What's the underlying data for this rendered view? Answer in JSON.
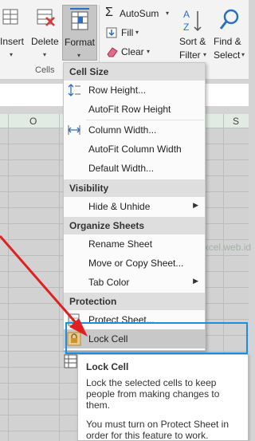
{
  "ribbon": {
    "insert_label": "Insert",
    "delete_label": "Delete",
    "format_label": "Format",
    "cells_group_label": "Cells",
    "autosum_label": "AutoSum",
    "fill_label": "Fill",
    "clear_label": "Clear",
    "sort_label_line1": "Sort &",
    "sort_label_line2": "Filter",
    "find_label_line1": "Find &",
    "find_label_line2": "Select"
  },
  "sheet": {
    "columns": [
      "O",
      "S"
    ]
  },
  "menu": {
    "sections": {
      "cell_size": "Cell Size",
      "visibility": "Visibility",
      "organize_sheets": "Organize Sheets",
      "protection": "Protection"
    },
    "items": {
      "row_height": "Row Height...",
      "autofit_row_height": "AutoFit Row Height",
      "column_width": "Column Width...",
      "autofit_column_width": "AutoFit Column Width",
      "default_width": "Default Width...",
      "hide_unhide": "Hide & Unhide",
      "rename_sheet": "Rename Sheet",
      "move_copy_sheet": "Move or Copy Sheet...",
      "tab_color": "Tab Color",
      "protect_sheet": "Protect Sheet...",
      "lock_cell": "Lock Cell"
    }
  },
  "tooltip": {
    "title": "Lock Cell",
    "p1": "Lock the selected cells to keep people from making changes to them.",
    "p2": "You must turn on Protect Sheet in order for this feature to work."
  },
  "watermark": "www.KelasExcel.web.id",
  "colors": {
    "highlight_box": "#1e8fe0",
    "arrow": "#e02020",
    "column_header": "#e1ebe3"
  }
}
